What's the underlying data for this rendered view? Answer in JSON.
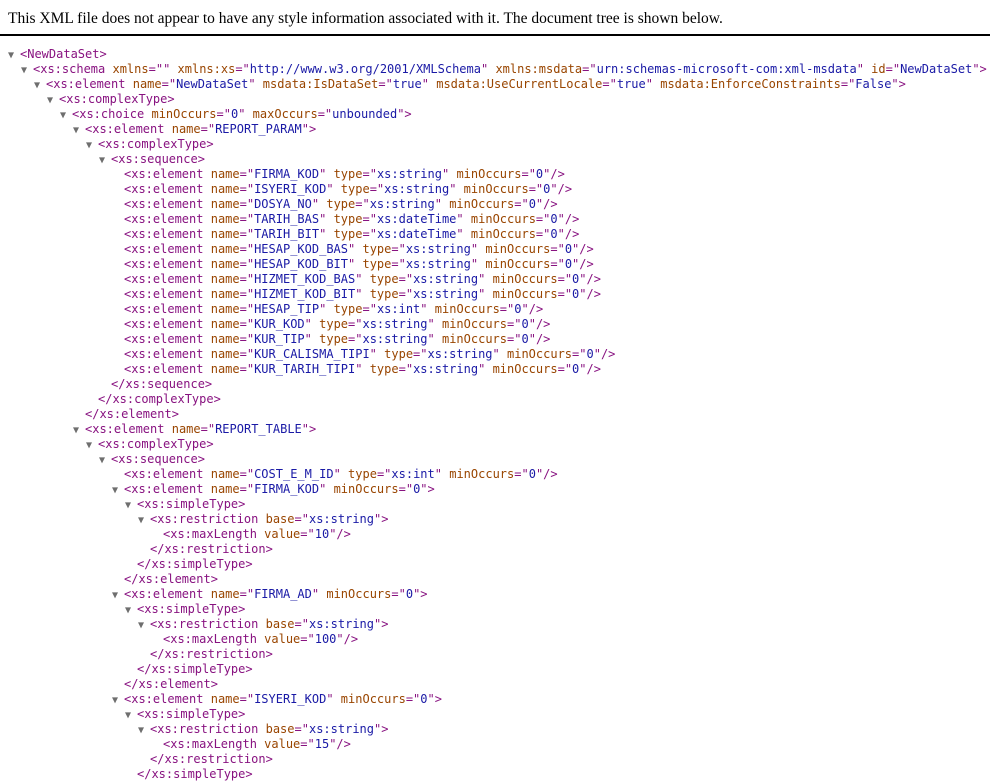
{
  "info_message": "This XML file does not appear to have any style information associated with it. The document tree is shown below.",
  "colors": {
    "tag": "#881280",
    "attr_name": "#994500",
    "attr_value": "#1a1aa6",
    "toggle": "#6e6e6e"
  },
  "toggle_icon": "triangle-down-icon",
  "lines": [
    {
      "depth": 0,
      "toggle": true,
      "kind": "open",
      "tag": "NewDataSet",
      "attrs": []
    },
    {
      "depth": 1,
      "toggle": true,
      "kind": "open",
      "tag": "xs:schema",
      "attrs": [
        {
          "name": "xmlns",
          "value": ""
        },
        {
          "name": "xmlns:xs",
          "value": "http://www.w3.org/2001/XMLSchema"
        },
        {
          "name": "xmlns:msdata",
          "value": "urn:schemas-microsoft-com:xml-msdata"
        },
        {
          "name": "id",
          "value": "NewDataSet"
        }
      ]
    },
    {
      "depth": 2,
      "toggle": true,
      "kind": "open",
      "tag": "xs:element",
      "attrs": [
        {
          "name": "name",
          "value": "NewDataSet"
        },
        {
          "name": "msdata:IsDataSet",
          "value": "true"
        },
        {
          "name": "msdata:UseCurrentLocale",
          "value": "true"
        },
        {
          "name": "msdata:EnforceConstraints",
          "value": "False"
        }
      ]
    },
    {
      "depth": 3,
      "toggle": true,
      "kind": "open",
      "tag": "xs:complexType",
      "attrs": []
    },
    {
      "depth": 4,
      "toggle": true,
      "kind": "open",
      "tag": "xs:choice",
      "attrs": [
        {
          "name": "minOccurs",
          "value": "0"
        },
        {
          "name": "maxOccurs",
          "value": "unbounded"
        }
      ]
    },
    {
      "depth": 5,
      "toggle": true,
      "kind": "open",
      "tag": "xs:element",
      "attrs": [
        {
          "name": "name",
          "value": "REPORT_PARAM"
        }
      ]
    },
    {
      "depth": 6,
      "toggle": true,
      "kind": "open",
      "tag": "xs:complexType",
      "attrs": []
    },
    {
      "depth": 7,
      "toggle": true,
      "kind": "open",
      "tag": "xs:sequence",
      "attrs": []
    },
    {
      "depth": 8,
      "toggle": false,
      "kind": "self",
      "tag": "xs:element",
      "attrs": [
        {
          "name": "name",
          "value": "FIRMA_KOD"
        },
        {
          "name": "type",
          "value": "xs:string"
        },
        {
          "name": "minOccurs",
          "value": "0"
        }
      ]
    },
    {
      "depth": 8,
      "toggle": false,
      "kind": "self",
      "tag": "xs:element",
      "attrs": [
        {
          "name": "name",
          "value": "ISYERI_KOD"
        },
        {
          "name": "type",
          "value": "xs:string"
        },
        {
          "name": "minOccurs",
          "value": "0"
        }
      ]
    },
    {
      "depth": 8,
      "toggle": false,
      "kind": "self",
      "tag": "xs:element",
      "attrs": [
        {
          "name": "name",
          "value": "DOSYA_NO"
        },
        {
          "name": "type",
          "value": "xs:string"
        },
        {
          "name": "minOccurs",
          "value": "0"
        }
      ]
    },
    {
      "depth": 8,
      "toggle": false,
      "kind": "self",
      "tag": "xs:element",
      "attrs": [
        {
          "name": "name",
          "value": "TARIH_BAS"
        },
        {
          "name": "type",
          "value": "xs:dateTime"
        },
        {
          "name": "minOccurs",
          "value": "0"
        }
      ]
    },
    {
      "depth": 8,
      "toggle": false,
      "kind": "self",
      "tag": "xs:element",
      "attrs": [
        {
          "name": "name",
          "value": "TARIH_BIT"
        },
        {
          "name": "type",
          "value": "xs:dateTime"
        },
        {
          "name": "minOccurs",
          "value": "0"
        }
      ]
    },
    {
      "depth": 8,
      "toggle": false,
      "kind": "self",
      "tag": "xs:element",
      "attrs": [
        {
          "name": "name",
          "value": "HESAP_KOD_BAS"
        },
        {
          "name": "type",
          "value": "xs:string"
        },
        {
          "name": "minOccurs",
          "value": "0"
        }
      ]
    },
    {
      "depth": 8,
      "toggle": false,
      "kind": "self",
      "tag": "xs:element",
      "attrs": [
        {
          "name": "name",
          "value": "HESAP_KOD_BIT"
        },
        {
          "name": "type",
          "value": "xs:string"
        },
        {
          "name": "minOccurs",
          "value": "0"
        }
      ]
    },
    {
      "depth": 8,
      "toggle": false,
      "kind": "self",
      "tag": "xs:element",
      "attrs": [
        {
          "name": "name",
          "value": "HIZMET_KOD_BAS"
        },
        {
          "name": "type",
          "value": "xs:string"
        },
        {
          "name": "minOccurs",
          "value": "0"
        }
      ]
    },
    {
      "depth": 8,
      "toggle": false,
      "kind": "self",
      "tag": "xs:element",
      "attrs": [
        {
          "name": "name",
          "value": "HIZMET_KOD_BIT"
        },
        {
          "name": "type",
          "value": "xs:string"
        },
        {
          "name": "minOccurs",
          "value": "0"
        }
      ]
    },
    {
      "depth": 8,
      "toggle": false,
      "kind": "self",
      "tag": "xs:element",
      "attrs": [
        {
          "name": "name",
          "value": "HESAP_TIP"
        },
        {
          "name": "type",
          "value": "xs:int"
        },
        {
          "name": "minOccurs",
          "value": "0"
        }
      ]
    },
    {
      "depth": 8,
      "toggle": false,
      "kind": "self",
      "tag": "xs:element",
      "attrs": [
        {
          "name": "name",
          "value": "KUR_KOD"
        },
        {
          "name": "type",
          "value": "xs:string"
        },
        {
          "name": "minOccurs",
          "value": "0"
        }
      ]
    },
    {
      "depth": 8,
      "toggle": false,
      "kind": "self",
      "tag": "xs:element",
      "attrs": [
        {
          "name": "name",
          "value": "KUR_TIP"
        },
        {
          "name": "type",
          "value": "xs:string"
        },
        {
          "name": "minOccurs",
          "value": "0"
        }
      ]
    },
    {
      "depth": 8,
      "toggle": false,
      "kind": "self",
      "tag": "xs:element",
      "attrs": [
        {
          "name": "name",
          "value": "KUR_CALISMA_TIPI"
        },
        {
          "name": "type",
          "value": "xs:string"
        },
        {
          "name": "minOccurs",
          "value": "0"
        }
      ]
    },
    {
      "depth": 8,
      "toggle": false,
      "kind": "self",
      "tag": "xs:element",
      "attrs": [
        {
          "name": "name",
          "value": "KUR_TARIH_TIPI"
        },
        {
          "name": "type",
          "value": "xs:string"
        },
        {
          "name": "minOccurs",
          "value": "0"
        }
      ]
    },
    {
      "depth": 7,
      "toggle": false,
      "kind": "close",
      "tag": "xs:sequence",
      "attrs": []
    },
    {
      "depth": 6,
      "toggle": false,
      "kind": "close",
      "tag": "xs:complexType",
      "attrs": []
    },
    {
      "depth": 5,
      "toggle": false,
      "kind": "close",
      "tag": "xs:element",
      "attrs": []
    },
    {
      "depth": 5,
      "toggle": true,
      "kind": "open",
      "tag": "xs:element",
      "attrs": [
        {
          "name": "name",
          "value": "REPORT_TABLE"
        }
      ]
    },
    {
      "depth": 6,
      "toggle": true,
      "kind": "open",
      "tag": "xs:complexType",
      "attrs": []
    },
    {
      "depth": 7,
      "toggle": true,
      "kind": "open",
      "tag": "xs:sequence",
      "attrs": []
    },
    {
      "depth": 8,
      "toggle": false,
      "kind": "self",
      "tag": "xs:element",
      "attrs": [
        {
          "name": "name",
          "value": "COST_E_M_ID"
        },
        {
          "name": "type",
          "value": "xs:int"
        },
        {
          "name": "minOccurs",
          "value": "0"
        }
      ]
    },
    {
      "depth": 8,
      "toggle": true,
      "kind": "open",
      "tag": "xs:element",
      "attrs": [
        {
          "name": "name",
          "value": "FIRMA_KOD"
        },
        {
          "name": "minOccurs",
          "value": "0"
        }
      ]
    },
    {
      "depth": 9,
      "toggle": true,
      "kind": "open",
      "tag": "xs:simpleType",
      "attrs": []
    },
    {
      "depth": 10,
      "toggle": true,
      "kind": "open",
      "tag": "xs:restriction",
      "attrs": [
        {
          "name": "base",
          "value": "xs:string"
        }
      ]
    },
    {
      "depth": 11,
      "toggle": false,
      "kind": "self",
      "tag": "xs:maxLength",
      "attrs": [
        {
          "name": "value",
          "value": "10"
        }
      ]
    },
    {
      "depth": 10,
      "toggle": false,
      "kind": "close",
      "tag": "xs:restriction",
      "attrs": []
    },
    {
      "depth": 9,
      "toggle": false,
      "kind": "close",
      "tag": "xs:simpleType",
      "attrs": []
    },
    {
      "depth": 8,
      "toggle": false,
      "kind": "close",
      "tag": "xs:element",
      "attrs": []
    },
    {
      "depth": 8,
      "toggle": true,
      "kind": "open",
      "tag": "xs:element",
      "attrs": [
        {
          "name": "name",
          "value": "FIRMA_AD"
        },
        {
          "name": "minOccurs",
          "value": "0"
        }
      ]
    },
    {
      "depth": 9,
      "toggle": true,
      "kind": "open",
      "tag": "xs:simpleType",
      "attrs": []
    },
    {
      "depth": 10,
      "toggle": true,
      "kind": "open",
      "tag": "xs:restriction",
      "attrs": [
        {
          "name": "base",
          "value": "xs:string"
        }
      ]
    },
    {
      "depth": 11,
      "toggle": false,
      "kind": "self",
      "tag": "xs:maxLength",
      "attrs": [
        {
          "name": "value",
          "value": "100"
        }
      ]
    },
    {
      "depth": 10,
      "toggle": false,
      "kind": "close",
      "tag": "xs:restriction",
      "attrs": []
    },
    {
      "depth": 9,
      "toggle": false,
      "kind": "close",
      "tag": "xs:simpleType",
      "attrs": []
    },
    {
      "depth": 8,
      "toggle": false,
      "kind": "close",
      "tag": "xs:element",
      "attrs": []
    },
    {
      "depth": 8,
      "toggle": true,
      "kind": "open",
      "tag": "xs:element",
      "attrs": [
        {
          "name": "name",
          "value": "ISYERI_KOD"
        },
        {
          "name": "minOccurs",
          "value": "0"
        }
      ]
    },
    {
      "depth": 9,
      "toggle": true,
      "kind": "open",
      "tag": "xs:simpleType",
      "attrs": []
    },
    {
      "depth": 10,
      "toggle": true,
      "kind": "open",
      "tag": "xs:restriction",
      "attrs": [
        {
          "name": "base",
          "value": "xs:string"
        }
      ]
    },
    {
      "depth": 11,
      "toggle": false,
      "kind": "self",
      "tag": "xs:maxLength",
      "attrs": [
        {
          "name": "value",
          "value": "15"
        }
      ]
    },
    {
      "depth": 10,
      "toggle": false,
      "kind": "close",
      "tag": "xs:restriction",
      "attrs": []
    },
    {
      "depth": 9,
      "toggle": false,
      "kind": "close",
      "tag": "xs:simpleType",
      "attrs": []
    }
  ]
}
